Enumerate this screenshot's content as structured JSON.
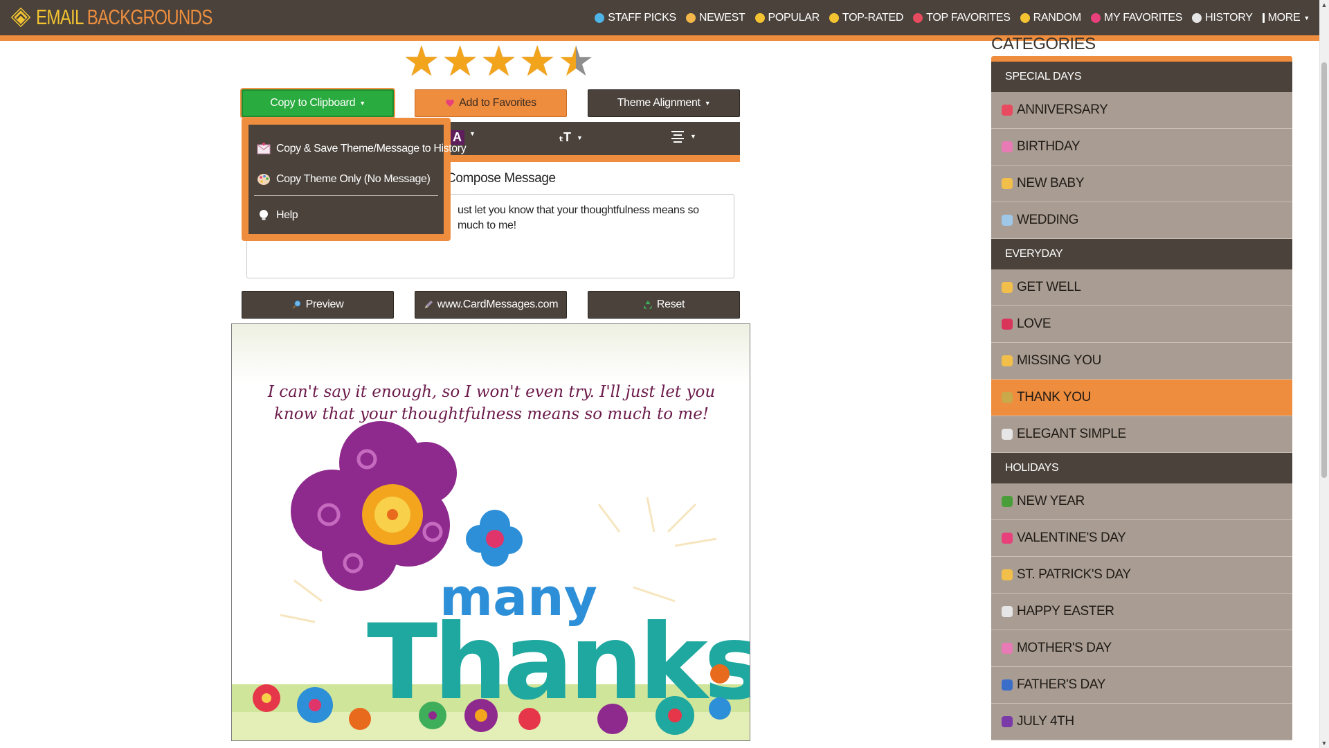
{
  "brand": {
    "part1": "EMAIL",
    "part2": "BACKGROUNDS"
  },
  "nav": [
    {
      "label": "STAFF PICKS",
      "icon": "diamond-icon",
      "color": "#4fb4e8"
    },
    {
      "label": "NEWEST",
      "icon": "baby-face-icon",
      "color": "#f2b64a"
    },
    {
      "label": "POPULAR",
      "icon": "thumbs-up-icon",
      "color": "#f3c331"
    },
    {
      "label": "TOP-RATED",
      "icon": "star-icon",
      "color": "#f3c331"
    },
    {
      "label": "TOP FAVORITES",
      "icon": "heart-face-icon",
      "color": "#e84a5f"
    },
    {
      "label": "RANDOM",
      "icon": "sparkles-icon",
      "color": "#f3c331"
    },
    {
      "label": "MY FAVORITES",
      "icon": "heart-icon",
      "color": "#e8407a"
    },
    {
      "label": "HISTORY",
      "icon": "clock-icon",
      "color": "#e6e6e6"
    },
    {
      "label": "MORE",
      "icon": "kebab-icon",
      "color": "#ffffff"
    }
  ],
  "rating": {
    "value": 4.5,
    "max": 5
  },
  "buttons": {
    "copy": "Copy to Clipboard",
    "favorites": "Add to Favorites",
    "theme": "Theme Alignment",
    "preview": "Preview",
    "cardmessages": "www.CardMessages.com",
    "reset": "Reset"
  },
  "dropdown": {
    "items": [
      {
        "label": "Copy & Save Theme/Message to History",
        "icon": "envelope-icon"
      },
      {
        "label": "Copy Theme Only (No Message)",
        "icon": "palette-icon"
      },
      {
        "label": "Help",
        "icon": "lightbulb-icon"
      }
    ]
  },
  "compose": {
    "label": "Compose Message",
    "text": "ust let you know that your thoughtfulness means so much to me!"
  },
  "card": {
    "message": "I can't say it enough, so I won't even try.  I'll just let you know that your thoughtfulness means so much to me!",
    "art_line1": "many",
    "art_line2": "Thanks!"
  },
  "sidebar": {
    "title": "CATEGORIES",
    "sections": [
      {
        "heading": "SPECIAL DAYS",
        "items": [
          {
            "label": "ANNIVERSARY",
            "icon": "rings-icon",
            "color": "#e84a5f"
          },
          {
            "label": "BIRTHDAY",
            "icon": "cake-icon",
            "color": "#e87ab5"
          },
          {
            "label": "NEW BABY",
            "icon": "baby-icon",
            "color": "#f2c04a"
          },
          {
            "label": "WEDDING",
            "icon": "ring-icon",
            "color": "#9ec7e8"
          }
        ]
      },
      {
        "heading": "EVERYDAY",
        "items": [
          {
            "label": "GET WELL",
            "icon": "sick-face-icon",
            "color": "#f2c04a"
          },
          {
            "label": "LOVE",
            "icon": "lips-icon",
            "color": "#d9345a"
          },
          {
            "label": "MISSING YOU",
            "icon": "sad-face-icon",
            "color": "#f2c04a"
          },
          {
            "label": "THANK YOU",
            "icon": "praying-hands-icon",
            "color": "#c9a94a",
            "active": true
          },
          {
            "label": "ELEGANT SIMPLE",
            "icon": "dove-icon",
            "color": "#e6e6e6"
          }
        ]
      },
      {
        "heading": "HOLIDAYS",
        "items": [
          {
            "label": "NEW YEAR",
            "icon": "champagne-icon",
            "color": "#4a9e3a"
          },
          {
            "label": "VALENTINE'S DAY",
            "icon": "heart-icon",
            "color": "#e8407a"
          },
          {
            "label": "ST. PATRICK'S DAY",
            "icon": "beer-icon",
            "color": "#f2c04a"
          },
          {
            "label": "HAPPY EASTER",
            "icon": "bunny-icon",
            "color": "#e6e6e6"
          },
          {
            "label": "MOTHER'S DAY",
            "icon": "flower-icon",
            "color": "#e87ab5"
          },
          {
            "label": "FATHER'S DAY",
            "icon": "necktie-icon",
            "color": "#3a6ec8"
          },
          {
            "label": "JULY 4TH",
            "icon": "fireworks-icon",
            "color": "#7a3aa8"
          }
        ]
      }
    ]
  }
}
